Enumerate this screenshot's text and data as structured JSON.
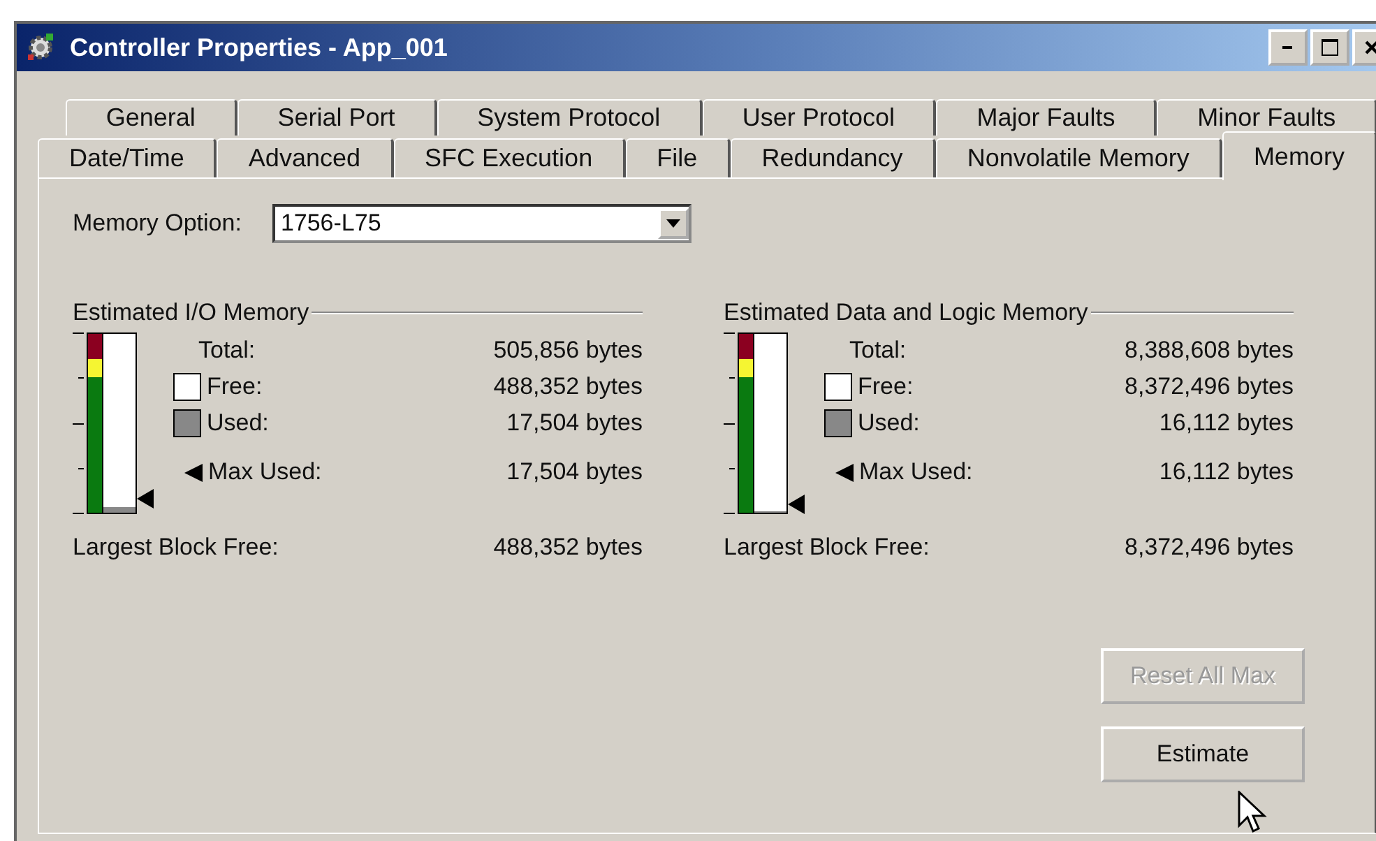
{
  "window": {
    "title": "Controller Properties - App_001"
  },
  "tab_rows": [
    [
      {
        "label": "General",
        "selected": false
      },
      {
        "label": "Serial Port",
        "selected": false
      },
      {
        "label": "System Protocol",
        "selected": false
      },
      {
        "label": "User Protocol",
        "selected": false
      },
      {
        "label": "Major Faults",
        "selected": false
      },
      {
        "label": "Minor Faults",
        "selected": false
      }
    ],
    [
      {
        "label": "Date/Time",
        "selected": false
      },
      {
        "label": "Advanced",
        "selected": false
      },
      {
        "label": "SFC Execution",
        "selected": false
      },
      {
        "label": "File",
        "selected": false
      },
      {
        "label": "Redundancy",
        "selected": false
      },
      {
        "label": "Nonvolatile Memory",
        "selected": false
      },
      {
        "label": "Memory",
        "selected": true
      }
    ]
  ],
  "memory_option": {
    "label": "Memory Option:",
    "value": "1756-L75"
  },
  "sections": [
    {
      "title": "Estimated I/O Memory",
      "gauge": {
        "level": 0.035
      },
      "rows": [
        {
          "kind": "total",
          "label": "Total:",
          "value": "505,856 bytes"
        },
        {
          "kind": "free",
          "label": "Free:",
          "value": "488,352 bytes"
        },
        {
          "kind": "used",
          "label": "Used:",
          "value": "17,504 bytes"
        },
        {
          "kind": "max",
          "label": "Max Used:",
          "value": "17,504 bytes"
        }
      ],
      "largest": {
        "label": "Largest Block Free:",
        "value": "488,352 bytes"
      }
    },
    {
      "title": "Estimated Data and Logic Memory",
      "gauge": {
        "level": 0.002
      },
      "rows": [
        {
          "kind": "total",
          "label": "Total:",
          "value": "8,388,608 bytes"
        },
        {
          "kind": "free",
          "label": "Free:",
          "value": "8,372,496 bytes"
        },
        {
          "kind": "used",
          "label": "Used:",
          "value": "16,112 bytes"
        },
        {
          "kind": "max",
          "label": "Max Used:",
          "value": "16,112 bytes"
        }
      ],
      "largest": {
        "label": "Largest Block Free:",
        "value": "8,372,496 bytes"
      }
    }
  ],
  "buttons": [
    {
      "label": "Reset All Max",
      "disabled": true
    },
    {
      "label": "Estimate",
      "disabled": false
    }
  ]
}
